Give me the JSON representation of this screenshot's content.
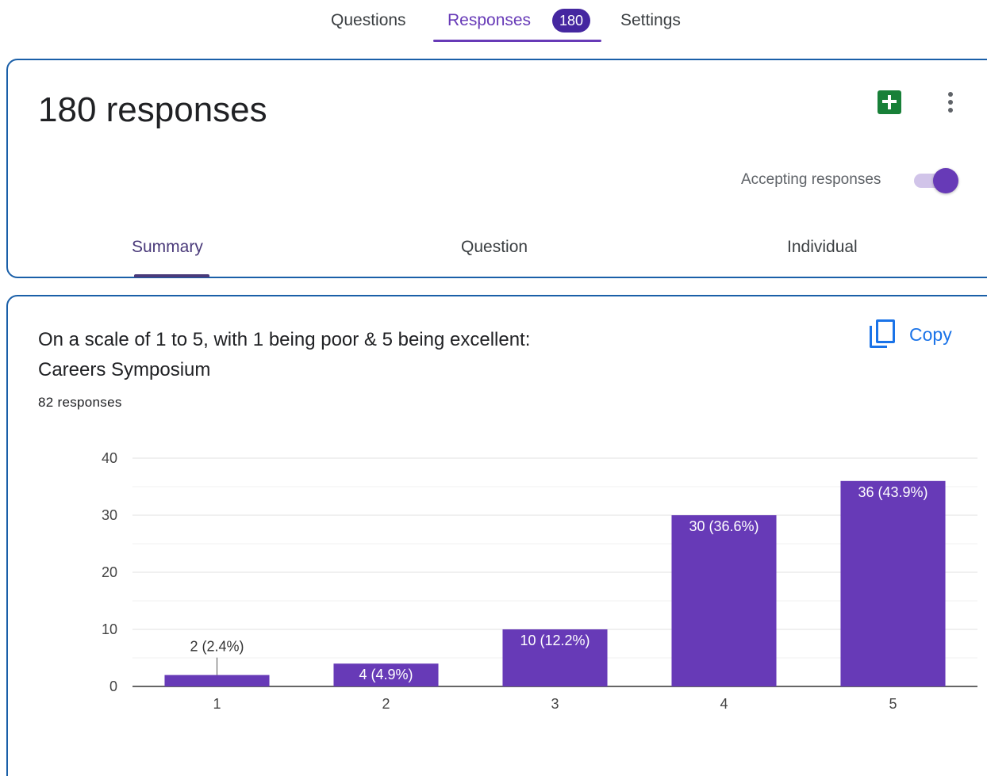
{
  "top_tabs": {
    "questions": "Questions",
    "responses": "Responses",
    "responses_badge": "180",
    "settings": "Settings"
  },
  "header": {
    "title": "180 responses",
    "accepting_label": "Accepting responses",
    "accepting_on": true,
    "sheets_icon": "google-sheets-icon",
    "more_icon": "more-vert-icon"
  },
  "sub_tabs": {
    "summary": "Summary",
    "question": "Question",
    "individual": "Individual",
    "active": "summary"
  },
  "question": {
    "title_line1": "On a scale of 1 to 5, with 1 being poor & 5 being excellent:",
    "title_line2": "Careers Symposium",
    "response_count": "82 responses",
    "copy_label": "Copy"
  },
  "colors": {
    "accent": "#673ab7",
    "bar": "#673ab7",
    "badge": "#4527a0",
    "link": "#1a73e8",
    "card_border": "#1a5fa8",
    "sheets": "#188038"
  },
  "chart_data": {
    "type": "bar",
    "categories": [
      "1",
      "2",
      "3",
      "4",
      "5"
    ],
    "values": [
      2,
      4,
      10,
      30,
      36
    ],
    "labels": [
      "2 (2.4%)",
      "4 (4.9%)",
      "10 (12.2%)",
      "30 (36.6%)",
      "36 (43.9%)"
    ],
    "yticks": [
      0,
      10,
      20,
      30,
      40
    ],
    "ylim": [
      0,
      40
    ],
    "grid": true,
    "legend": "none"
  }
}
